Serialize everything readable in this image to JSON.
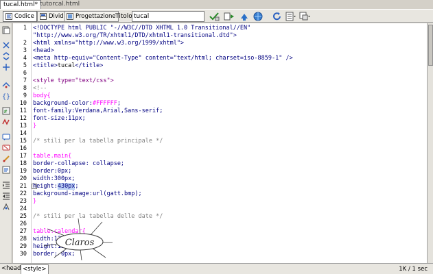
{
  "doc_tabs": [
    "tucal.html*",
    "tutorcal.html"
  ],
  "toolbar": {
    "view_buttons": [
      "Codice",
      "Dividi",
      "Progettazione"
    ],
    "title_label": "Titolo:",
    "title_value": "tucal"
  },
  "editor": {
    "lines": [
      {
        "n": "1",
        "segs": [
          [
            "c-tag",
            "<!DOCTYPE html PUBLIC \"-//W3C//DTD XHTML 1.0 Transitional//EN\""
          ]
        ]
      },
      {
        "n": "",
        "segs": [
          [
            "c-tag",
            "\"http://www.w3.org/TR/xhtml1/DTD/xhtml1-transitional.dtd\">"
          ]
        ]
      },
      {
        "n": "2",
        "segs": [
          [
            "c-tag",
            "<html xmlns=\"http://www.w3.org/1999/xhtml\">"
          ]
        ]
      },
      {
        "n": "3",
        "segs": [
          [
            "c-tag",
            "<head>"
          ]
        ]
      },
      {
        "n": "4",
        "segs": [
          [
            "c-tag",
            "<meta http-equiv=\"Content-Type\" content=\"text/html; charset=iso-8859-1\" />"
          ]
        ]
      },
      {
        "n": "5",
        "segs": [
          [
            "c-tag",
            "<title>"
          ],
          [
            "",
            "tucal"
          ],
          [
            "c-tag",
            "</title>"
          ]
        ]
      },
      {
        "n": "6",
        "segs": []
      },
      {
        "n": "7",
        "segs": [
          [
            "c-css",
            "<style type=\"text/css\">"
          ]
        ]
      },
      {
        "n": "8",
        "segs": [
          [
            "c-cmt",
            "<!--"
          ]
        ]
      },
      {
        "n": "9",
        "segs": [
          [
            "c-sel",
            "body{"
          ]
        ]
      },
      {
        "n": "10",
        "segs": [
          [
            "c-prop",
            "background-color:"
          ],
          [
            "c-sel",
            "#FFFFFF"
          ],
          [
            "c-prop",
            ";"
          ]
        ]
      },
      {
        "n": "11",
        "segs": [
          [
            "c-prop",
            "font-family:Verdana,Arial,Sans-serif;"
          ]
        ]
      },
      {
        "n": "12",
        "segs": [
          [
            "c-prop",
            "font-size:11px;"
          ]
        ]
      },
      {
        "n": "13",
        "segs": [
          [
            "c-sel",
            "}"
          ]
        ]
      },
      {
        "n": "14",
        "segs": []
      },
      {
        "n": "15",
        "segs": [
          [
            "c-cmt",
            "/* stili per la tabella principale */"
          ]
        ]
      },
      {
        "n": "16",
        "segs": []
      },
      {
        "n": "17",
        "segs": [
          [
            "c-sel",
            "table.main{"
          ]
        ]
      },
      {
        "n": "18",
        "segs": [
          [
            "c-prop",
            "border-collapse: collapse;"
          ]
        ]
      },
      {
        "n": "19",
        "segs": [
          [
            "c-prop",
            "border:0px;"
          ]
        ]
      },
      {
        "n": "20",
        "segs": [
          [
            "c-prop",
            "width:300px;"
          ]
        ]
      },
      {
        "n": "21",
        "segs": [
          [
            "c-prop",
            "height:"
          ],
          [
            "c-prop c-hl",
            "430px"
          ],
          [
            "c-prop",
            ";"
          ]
        ]
      },
      {
        "n": "22",
        "segs": [
          [
            "c-prop",
            "background-image:url(gatt.bmp);"
          ]
        ]
      },
      {
        "n": "23",
        "segs": [
          [
            "c-sel",
            "}"
          ]
        ]
      },
      {
        "n": "24",
        "segs": []
      },
      {
        "n": "25",
        "segs": [
          [
            "c-cmt",
            "/* stili per la tabella delle date */"
          ]
        ]
      },
      {
        "n": "26",
        "segs": []
      },
      {
        "n": "27",
        "segs": [
          [
            "c-sel",
            "table.calendar{"
          ]
        ]
      },
      {
        "n": "28",
        "segs": [
          [
            "c-prop",
            "width:130px;"
          ]
        ]
      },
      {
        "n": "29",
        "segs": [
          [
            "c-prop",
            "height:120px;"
          ]
        ]
      },
      {
        "n": "30",
        "segs": [
          [
            "c-prop",
            "border: 0px;"
          ]
        ]
      }
    ]
  },
  "watermark_text": "Claros",
  "statusbar": {
    "crumb1": "<head>",
    "crumb2": "<style>",
    "right": "1K / 1 sec"
  }
}
